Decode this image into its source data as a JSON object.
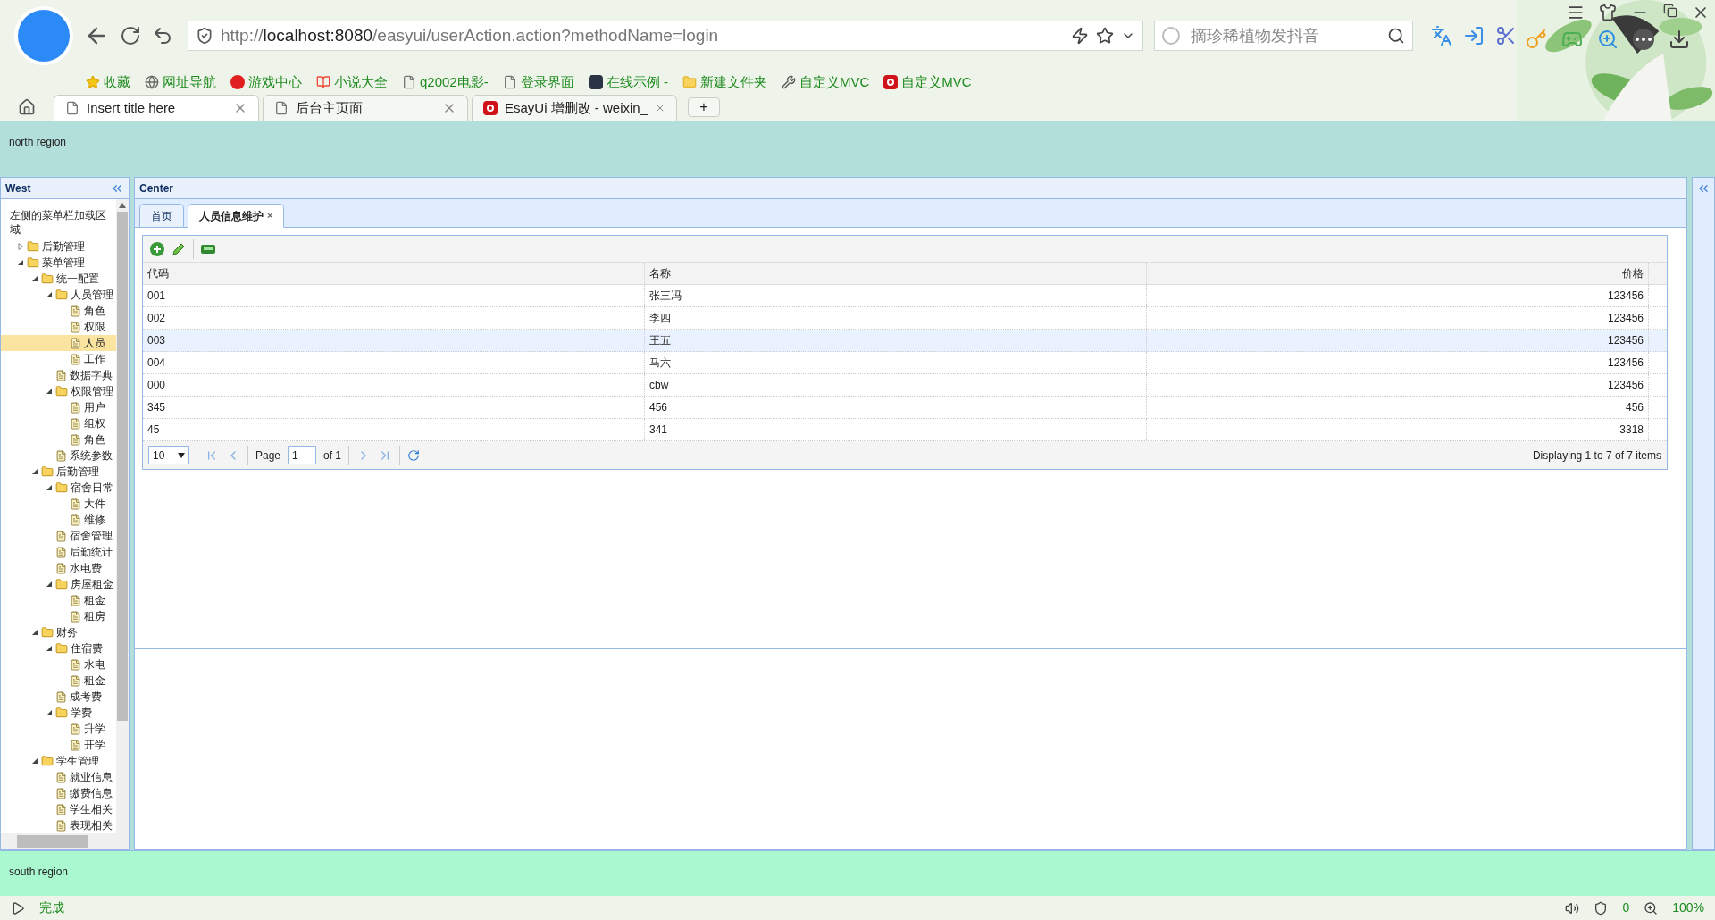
{
  "browser": {
    "url": {
      "prefix": "http://",
      "host": "localhost:8080",
      "path": "/easyui/userAction.action?methodName=login"
    },
    "search_placeholder": "摘珍稀植物发抖音",
    "bookmarks": [
      {
        "label": "收藏",
        "kind": "star"
      },
      {
        "label": "网址导航",
        "kind": "globe"
      },
      {
        "label": "游戏中心",
        "kind": "game"
      },
      {
        "label": "小说大全",
        "kind": "novel"
      },
      {
        "label": "q2002电影-",
        "kind": "page"
      },
      {
        "label": "登录界面",
        "kind": "page"
      },
      {
        "label": "在线示例 -",
        "kind": "app"
      },
      {
        "label": "新建文件夹",
        "kind": "folder"
      },
      {
        "label": "自定义MVC",
        "kind": "tool"
      },
      {
        "label": "自定义MVC",
        "kind": "brand"
      }
    ],
    "tabs": [
      {
        "title": "Insert title here",
        "kind": "page",
        "selected": true
      },
      {
        "title": "后台主页面",
        "kind": "page",
        "selected": false
      },
      {
        "title": "EsayUi 增删改 - weixin_",
        "kind": "brand",
        "selected": false
      }
    ],
    "new_tab": "+"
  },
  "north": {
    "text": "north region"
  },
  "west": {
    "title": "West",
    "caption": "左侧的菜单栏加载区域",
    "tree": [
      {
        "label": "后勤管理",
        "kind": "folder",
        "expanded": false
      },
      {
        "label": "菜单管理",
        "kind": "folder",
        "expanded": true,
        "children": [
          {
            "label": "统一配置",
            "kind": "folder",
            "expanded": true,
            "children": [
              {
                "label": "人员管理",
                "kind": "folder",
                "expanded": true,
                "children": [
                  {
                    "label": "角色",
                    "kind": "file",
                    "selected": false
                  },
                  {
                    "label": "权限",
                    "kind": "file",
                    "selected": false
                  },
                  {
                    "label": "人员",
                    "kind": "file",
                    "selected": true
                  },
                  {
                    "label": "工作",
                    "kind": "file",
                    "selected": false
                  }
                ]
              },
              {
                "label": "数据字典",
                "kind": "file",
                "selected": false
              },
              {
                "label": "权限管理",
                "kind": "folder",
                "expanded": true,
                "children": [
                  {
                    "label": "用户",
                    "kind": "file",
                    "selected": false
                  },
                  {
                    "label": "组权",
                    "kind": "file",
                    "selected": false
                  },
                  {
                    "label": "角色",
                    "kind": "file",
                    "selected": false
                  }
                ]
              },
              {
                "label": "系统参数",
                "kind": "file",
                "selected": false
              }
            ]
          },
          {
            "label": "后勤管理",
            "kind": "folder",
            "expanded": true,
            "children": [
              {
                "label": "宿舍日常",
                "kind": "folder",
                "expanded": true,
                "children": [
                  {
                    "label": "大件",
                    "kind": "file",
                    "selected": false
                  },
                  {
                    "label": "维修",
                    "kind": "file",
                    "selected": false
                  }
                ]
              },
              {
                "label": "宿舍管理",
                "kind": "file",
                "selected": false
              },
              {
                "label": "后勤统计",
                "kind": "file",
                "selected": false
              },
              {
                "label": "水电费",
                "kind": "file",
                "selected": false
              },
              {
                "label": "房屋租金",
                "kind": "folder",
                "expanded": true,
                "children": [
                  {
                    "label": "租金",
                    "kind": "file",
                    "selected": false
                  },
                  {
                    "label": "租房",
                    "kind": "file",
                    "selected": false
                  }
                ]
              }
            ]
          },
          {
            "label": "财务",
            "kind": "folder",
            "expanded": true,
            "children": [
              {
                "label": "住宿费",
                "kind": "folder",
                "expanded": true,
                "children": [
                  {
                    "label": "水电",
                    "kind": "file",
                    "selected": false
                  },
                  {
                    "label": "租金",
                    "kind": "file",
                    "selected": false
                  }
                ]
              },
              {
                "label": "成考费",
                "kind": "file",
                "selected": false
              },
              {
                "label": "学费",
                "kind": "folder",
                "expanded": true,
                "children": [
                  {
                    "label": "升学",
                    "kind": "file",
                    "selected": false
                  },
                  {
                    "label": "开学",
                    "kind": "file",
                    "selected": false
                  }
                ]
              }
            ]
          },
          {
            "label": "学生管理",
            "kind": "folder",
            "expanded": true,
            "children": [
              {
                "label": "就业信息",
                "kind": "file",
                "selected": false
              },
              {
                "label": "缴费信息",
                "kind": "file",
                "selected": false
              },
              {
                "label": "学生相关",
                "kind": "file",
                "selected": false
              },
              {
                "label": "表现相关",
                "kind": "file",
                "selected": false
              }
            ]
          }
        ]
      }
    ]
  },
  "center": {
    "title": "Center",
    "tabs": [
      {
        "label": "首页",
        "closable": false,
        "selected": false
      },
      {
        "label": "人员信息维护",
        "closable": true,
        "selected": true
      }
    ],
    "close_mark": "×",
    "grid": {
      "columns": [
        {
          "label": "代码",
          "kind": "text"
        },
        {
          "label": "名称",
          "kind": "text"
        },
        {
          "label": "价格",
          "kind": "number"
        }
      ],
      "rows": [
        {
          "cells": [
            "001",
            "张三冯",
            "123456"
          ],
          "selected": false
        },
        {
          "cells": [
            "002",
            "李四",
            "123456"
          ],
          "selected": false
        },
        {
          "cells": [
            "003",
            "王五",
            "123456"
          ],
          "selected": true
        },
        {
          "cells": [
            "004",
            "马六",
            "123456"
          ],
          "selected": false
        },
        {
          "cells": [
            "000",
            "cbw",
            "123456"
          ],
          "selected": false
        },
        {
          "cells": [
            "345",
            "456",
            "456"
          ],
          "selected": false
        },
        {
          "cells": [
            "45",
            "341",
            "3318"
          ],
          "selected": false
        }
      ],
      "pager": {
        "page_size": "10",
        "page_label": "Page",
        "page": "1",
        "of": "of 1",
        "info": "Displaying 1 to 7 of 7 items"
      }
    }
  },
  "south": {
    "text": "south region"
  },
  "status_bar": {
    "status": "完成",
    "count": "0",
    "zoom": "100%"
  }
}
